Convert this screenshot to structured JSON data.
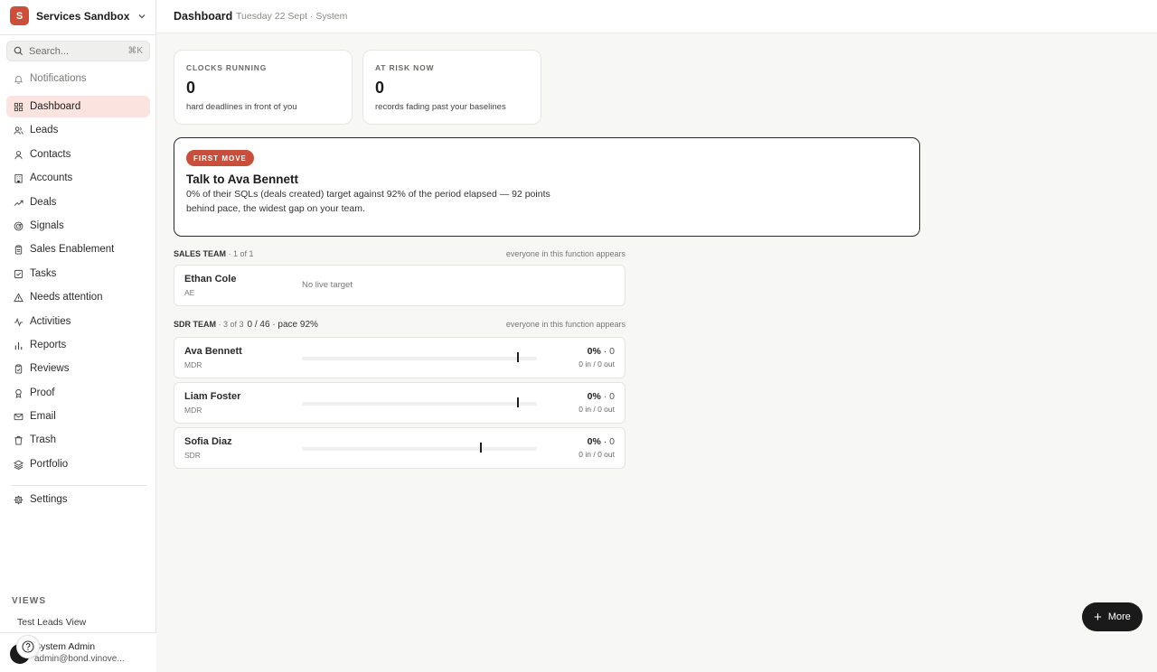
{
  "workspace": {
    "initial": "S",
    "name": "Services Sandbox"
  },
  "search": {
    "placeholder": "Search...",
    "shortcut": "⌘K"
  },
  "nav": [
    {
      "key": "notifications",
      "label": "Notifications",
      "icon": "bell-icon"
    },
    {
      "key": "dashboard",
      "label": "Dashboard",
      "icon": "grid-icon"
    },
    {
      "key": "leads",
      "label": "Leads",
      "icon": "users-icon"
    },
    {
      "key": "contacts",
      "label": "Contacts",
      "icon": "user-icon"
    },
    {
      "key": "accounts",
      "label": "Accounts",
      "icon": "building-icon"
    },
    {
      "key": "deals",
      "label": "Deals",
      "icon": "trend-icon"
    },
    {
      "key": "signals",
      "label": "Signals",
      "icon": "radar-icon"
    },
    {
      "key": "sales-enablement",
      "label": "Sales Enablement",
      "icon": "clipboard-icon"
    },
    {
      "key": "tasks",
      "label": "Tasks",
      "icon": "check-square-icon"
    },
    {
      "key": "needs-attention",
      "label": "Needs attention",
      "icon": "alert-triangle-icon"
    },
    {
      "key": "activities",
      "label": "Activities",
      "icon": "activity-icon"
    },
    {
      "key": "reports",
      "label": "Reports",
      "icon": "bar-chart-icon"
    },
    {
      "key": "reviews",
      "label": "Reviews",
      "icon": "clipboard-check-icon"
    },
    {
      "key": "proof",
      "label": "Proof",
      "icon": "award-icon"
    },
    {
      "key": "email",
      "label": "Email",
      "icon": "mail-icon"
    },
    {
      "key": "trash",
      "label": "Trash",
      "icon": "trash-icon"
    },
    {
      "key": "portfolio",
      "label": "Portfolio",
      "icon": "layers-icon"
    },
    {
      "key": "settings",
      "label": "Settings",
      "icon": "gear-icon"
    }
  ],
  "views": {
    "label": "VIEWS",
    "items": [
      "Test Leads View"
    ]
  },
  "user": {
    "name": "System Admin",
    "email": "admin@bond.vinove..."
  },
  "header": {
    "title": "Dashboard",
    "subtitle": "Tuesday 22 Sept · System"
  },
  "stats": [
    {
      "label": "CLOCKS RUNNING",
      "value": "0",
      "desc": "hard deadlines in front of you"
    },
    {
      "label": "AT RISK NOW",
      "value": "0",
      "desc": "records fading past your baselines"
    }
  ],
  "first_move": {
    "badge": "FIRST MOVE",
    "title": "Talk to Ava Bennett",
    "body": "0% of their SQLs (deals created) target against 92% of the period elapsed — 92 points behind pace, the widest gap on your team."
  },
  "sales_team": {
    "name": "SALES TEAM",
    "count": " · 1 of 1",
    "note": "everyone in this function appears",
    "members": [
      {
        "name": "Ethan Cole",
        "role": "AE",
        "status": "No live target"
      }
    ]
  },
  "sdr_team": {
    "name": "SDR TEAM",
    "count": " · 3 of 3",
    "summary": "0 / 46 · pace 92%",
    "note": "everyone in this function appears",
    "members": [
      {
        "name": "Ava Bennett",
        "role": "MDR",
        "pct": "0%",
        "count": " · 0",
        "io": "0 in / 0 out",
        "pace": 0.92
      },
      {
        "name": "Liam Foster",
        "role": "MDR",
        "pct": "0%",
        "count": " · 0",
        "io": "0 in / 0 out",
        "pace": 0.92
      },
      {
        "name": "Sofia Diaz",
        "role": "SDR",
        "pct": "0%",
        "count": " · 0",
        "io": "0 in / 0 out",
        "pace": 0.76
      }
    ]
  },
  "more_button": {
    "label": "More"
  },
  "colors": {
    "accent": "#c84f3b",
    "active_bg": "#fbe4df",
    "dark": "#1a1a1a"
  }
}
